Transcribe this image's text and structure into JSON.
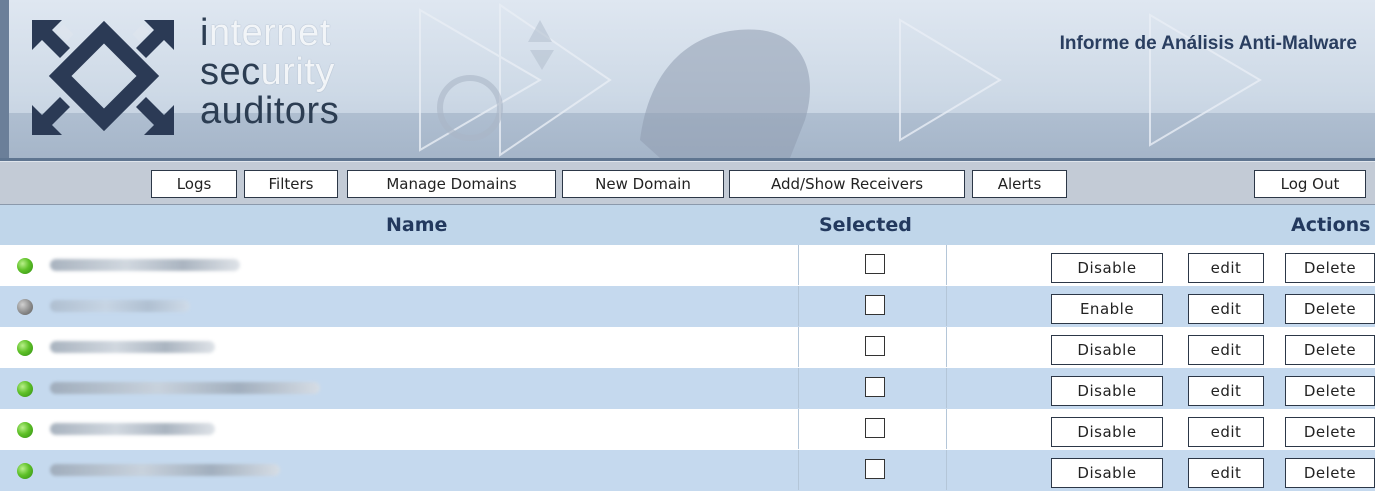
{
  "banner": {
    "logo_words": [
      {
        "hl": "i",
        "rest": "nternet"
      },
      {
        "hl": "sec",
        "rest": "urity"
      },
      {
        "hl": "auditors",
        "rest": ""
      }
    ],
    "title": "Informe de Análisis Anti-Malware"
  },
  "toolbar": {
    "buttons": [
      "Logs",
      "Filters",
      "Manage Domains",
      "New Domain",
      "Add/Show Receivers",
      "Alerts"
    ],
    "logout": "Log Out"
  },
  "table": {
    "headers": {
      "name": "Name",
      "selected": "Selected",
      "actions": "Actions"
    },
    "rows": [
      {
        "status": "enabled",
        "toggle": "Disable",
        "edit": "edit",
        "delete": "Delete"
      },
      {
        "status": "disabled",
        "toggle": "Enable",
        "edit": "edit",
        "delete": "Delete"
      },
      {
        "status": "enabled",
        "toggle": "Disable",
        "edit": "edit",
        "delete": "Delete"
      },
      {
        "status": "enabled",
        "toggle": "Disable",
        "edit": "edit",
        "delete": "Delete"
      },
      {
        "status": "enabled",
        "toggle": "Disable",
        "edit": "edit",
        "delete": "Delete"
      },
      {
        "status": "enabled",
        "toggle": "Disable",
        "edit": "edit",
        "delete": "Delete"
      }
    ]
  },
  "colors": {
    "header_bg": "#c0d6ea",
    "row_alt_bg": "#c5d9ee",
    "toolbar_bg": "#c3cbd6",
    "status_enabled": "#5fc128",
    "status_disabled": "#8b8b8b",
    "title_text": "#2a3e60"
  }
}
